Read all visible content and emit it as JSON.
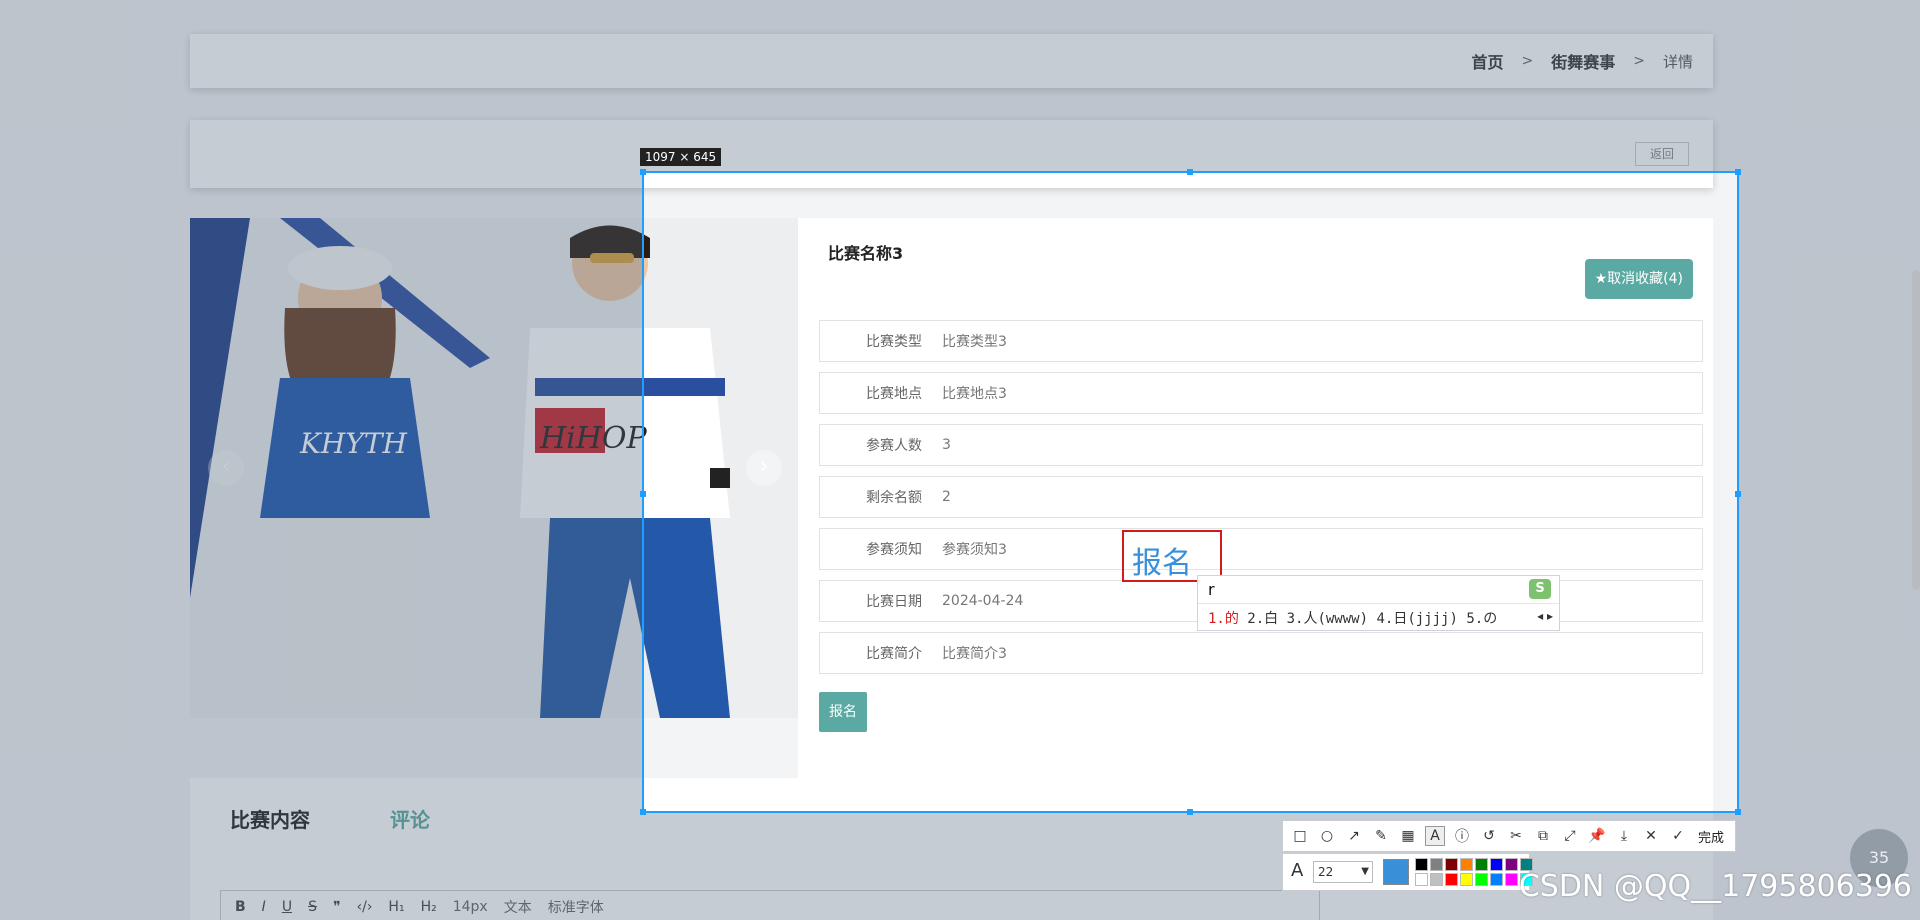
{
  "breadcrumb": {
    "home": "首页",
    "sep1": ">",
    "category": "街舞赛事",
    "sep2": ">",
    "current": "详情"
  },
  "back_button": "返回",
  "carousel": {
    "prev_icon": "‹",
    "next_icon": "›"
  },
  "detail": {
    "title": "比赛名称3",
    "favorite_button": "★取消收藏(4)",
    "rows": [
      {
        "label": "比赛类型",
        "value": "比赛类型3"
      },
      {
        "label": "比赛地点",
        "value": "比赛地点3"
      },
      {
        "label": "参赛人数",
        "value": "3"
      },
      {
        "label": "剩余名额",
        "value": "2"
      },
      {
        "label": "参赛须知",
        "value": "参赛须知3"
      },
      {
        "label": "比赛日期",
        "value": "2024-04-24"
      },
      {
        "label": "比赛简介",
        "value": "比赛简介3"
      }
    ],
    "signup_button": "报名"
  },
  "bottom": {
    "tab_content": "比赛内容",
    "tab_comments": "评论",
    "editor": {
      "bold": "B",
      "italic": "I",
      "underline": "U",
      "strike": "S",
      "quote": "❞",
      "code": "‹/›",
      "h1": "H₁",
      "h2": "H₂",
      "font_size": "14px",
      "block": "文本",
      "font_family": "标准字体"
    }
  },
  "screenshot_tool": {
    "size_label": "1097 × 645",
    "annotation_text": "报名",
    "ime": {
      "input": "r",
      "candidates": [
        "1.的",
        "2.白",
        "3.人(wwww)",
        "4.日(jjjj)",
        "5.の"
      ],
      "logo": "S"
    },
    "done_label": "完成",
    "font_size_value": "22",
    "current_color": "#3a8fd9",
    "palette": [
      "#000000",
      "#808080",
      "#800000",
      "#ff8000",
      "#008000",
      "#0000ff",
      "#800080",
      "#008080",
      "#ffffff",
      "#c0c0c0",
      "#ff0000",
      "#ffff00",
      "#00ff00",
      "#0080ff",
      "#ff00ff",
      "#00ffff"
    ]
  },
  "watermark": "CSDN @QQ__1795806396",
  "float_button": "35"
}
